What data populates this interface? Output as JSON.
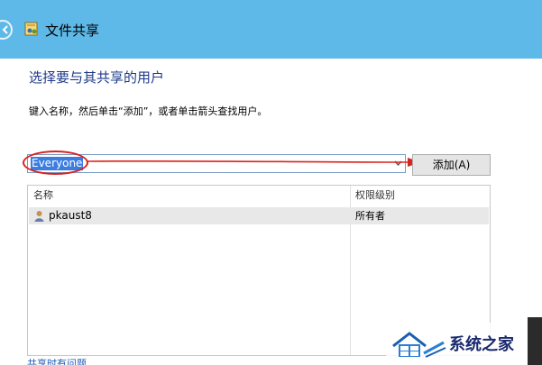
{
  "window": {
    "title": "文件共享"
  },
  "heading": "选择要与其共享的用户",
  "instruction": "键入名称，然后单击“添加”，或者单击箭头查找用户。",
  "name_input": {
    "value": "Everyone"
  },
  "add_button": {
    "label": "添加(A)"
  },
  "table": {
    "columns": [
      "名称",
      "权限级别"
    ],
    "rows": [
      {
        "name": "pkaust8",
        "permission": "所有者"
      }
    ]
  },
  "footer_link": "共享时有问题",
  "watermark": {
    "text": "系统之家"
  },
  "colors": {
    "titlebar": "#5fb9e8",
    "heading": "#1e3a8a",
    "annotation": "#d8231e",
    "selection": "#3b7de0"
  }
}
